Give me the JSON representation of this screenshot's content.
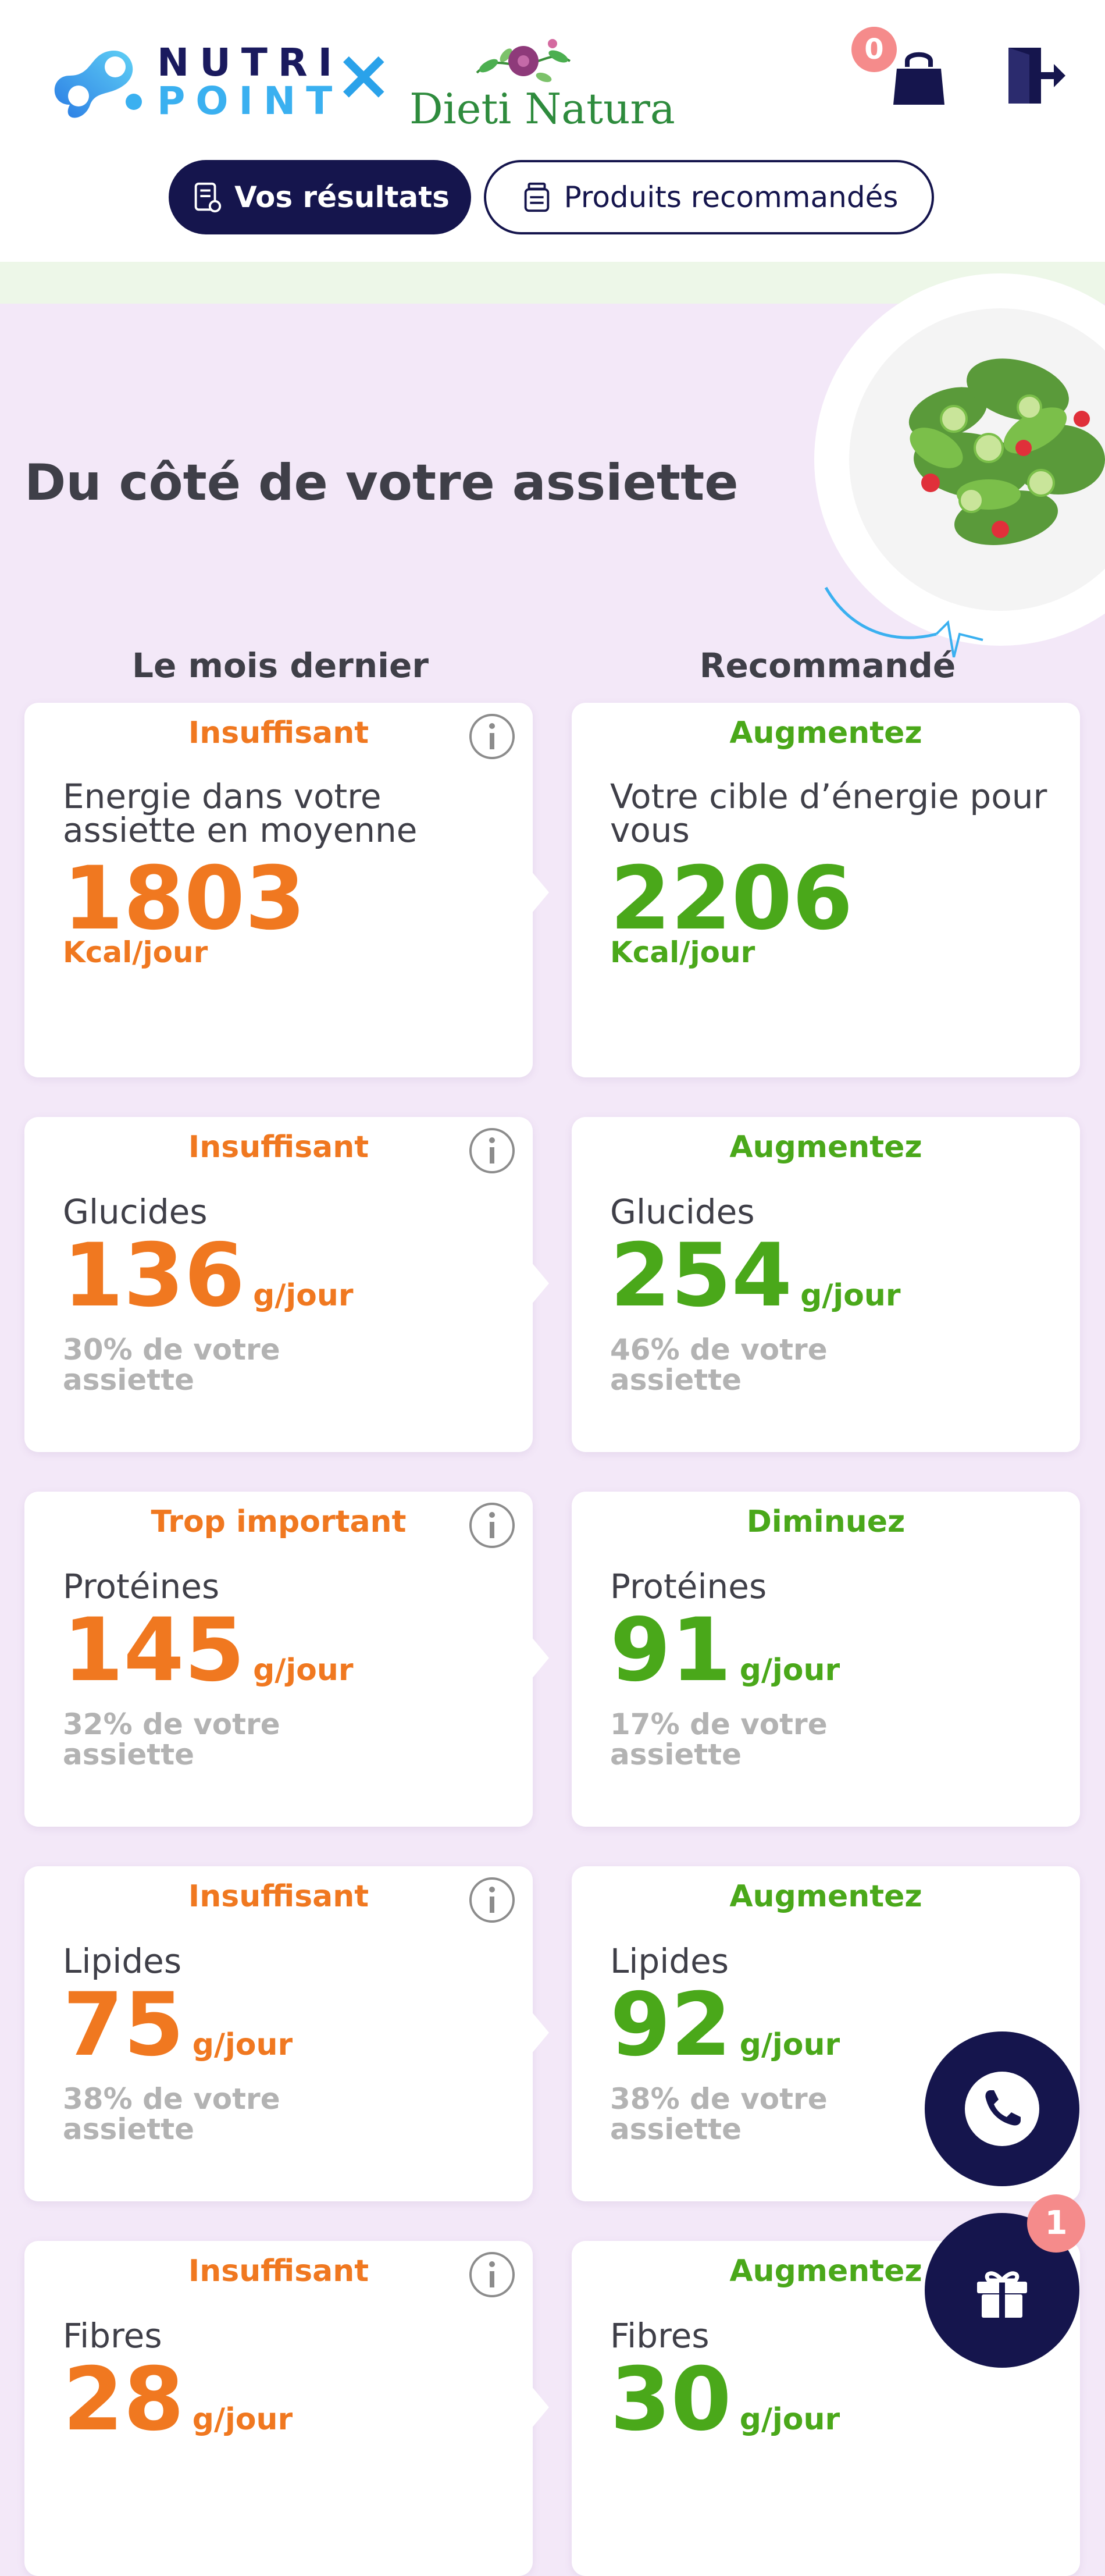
{
  "header": {
    "brand_line1": "NUTRI",
    "brand_line2": "POINT",
    "brand_separator": "×",
    "partner_name": "Dieti Natura",
    "cart_count": "0",
    "cart_icon": "shopping-bag-icon",
    "logout_icon": "logout-icon"
  },
  "tabs": {
    "results_label": "Vos résultats",
    "products_label": "Produits recommandés"
  },
  "section": {
    "title": "Du côté de votre assiette",
    "col_last_month": "Le mois dernier",
    "col_recommended": "Recommandé"
  },
  "rows": [
    {
      "left": {
        "status": "Insuffisant",
        "label": "Energie dans votre assiette en moyenne",
        "value": "1803",
        "unit": "Kcal/jour"
      },
      "right": {
        "status": "Augmentez",
        "label": "Votre cible d’énergie pour vous",
        "value": "2206",
        "unit": "Kcal/jour"
      }
    },
    {
      "left": {
        "status": "Insuffisant",
        "label": "Glucides",
        "value": "136",
        "unit": "g/jour",
        "pct": "30% de votre assiette"
      },
      "right": {
        "status": "Augmentez",
        "label": "Glucides",
        "value": "254",
        "unit": "g/jour",
        "pct": "46% de votre assiette"
      }
    },
    {
      "left": {
        "status": "Trop important",
        "label": "Protéines",
        "value": "145",
        "unit": "g/jour",
        "pct": "32% de votre assiette"
      },
      "right": {
        "status": "Diminuez",
        "label": "Protéines",
        "value": "91",
        "unit": "g/jour",
        "pct": "17% de votre assiette"
      }
    },
    {
      "left": {
        "status": "Insuffisant",
        "label": "Lipides",
        "value": "75",
        "unit": "g/jour",
        "pct": "38% de votre assiette"
      },
      "right": {
        "status": "Augmentez",
        "label": "Lipides",
        "value": "92",
        "unit": "g/jour",
        "pct": "38% de votre assiette"
      }
    },
    {
      "left": {
        "status": "Insuffisant",
        "label": "Fibres",
        "value": "28",
        "unit": "g/jour"
      },
      "right": {
        "status": "Augmentez",
        "label": "Fibres",
        "value": "30",
        "unit": "g/jour"
      }
    }
  ],
  "floating": {
    "phone_icon": "phone-icon",
    "gift_icon": "gift-icon",
    "gift_count": "1"
  },
  "colors": {
    "navy": "#15154d",
    "orange": "#f07820",
    "green": "#4aa81a",
    "background": "#f3e8f8",
    "badge": "#f58b8b"
  }
}
